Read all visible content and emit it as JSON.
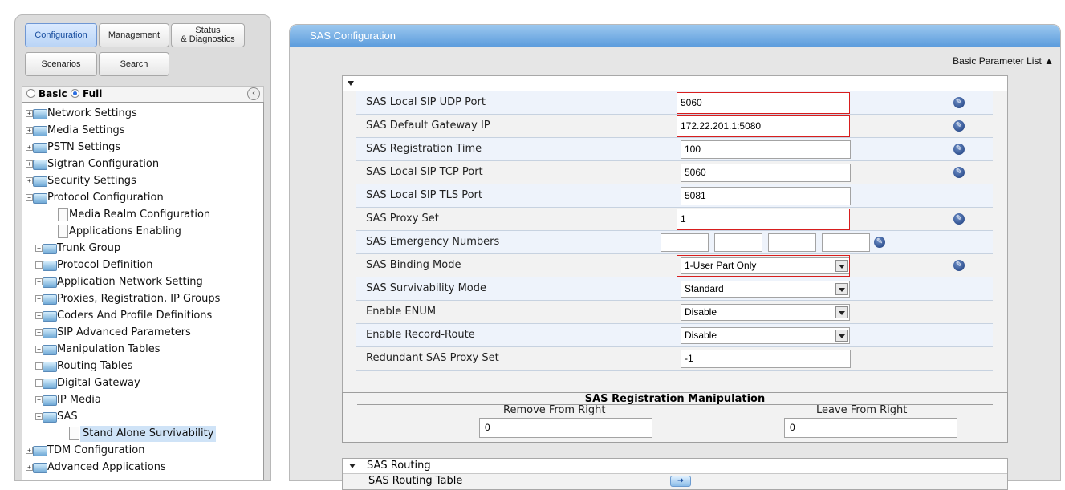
{
  "tabs": {
    "configuration": "Configuration",
    "management": "Management",
    "status_line1": "Status",
    "status_line2": "& Diagnostics",
    "scenarios": "Scenarios",
    "search": "Search"
  },
  "mode": {
    "basic": "Basic",
    "full": "Full",
    "selected": "Full"
  },
  "tree": [
    {
      "label": "Network Settings",
      "level": 0,
      "type": "folder",
      "expanded": false
    },
    {
      "label": "Media Settings",
      "level": 0,
      "type": "folder",
      "expanded": false
    },
    {
      "label": "PSTN Settings",
      "level": 0,
      "type": "folder",
      "expanded": false
    },
    {
      "label": "Sigtran Configuration",
      "level": 0,
      "type": "folder",
      "expanded": false
    },
    {
      "label": "Security Settings",
      "level": 0,
      "type": "folder",
      "expanded": false
    },
    {
      "label": "Protocol Configuration",
      "level": 0,
      "type": "folder",
      "expanded": true
    },
    {
      "label": "Media Realm Configuration",
      "level": 1,
      "type": "page"
    },
    {
      "label": "Applications Enabling",
      "level": 1,
      "type": "page"
    },
    {
      "label": "Trunk Group",
      "level": 1,
      "type": "folder",
      "expanded": false
    },
    {
      "label": "Protocol Definition",
      "level": 1,
      "type": "folder",
      "expanded": false
    },
    {
      "label": "Application Network Setting",
      "level": 1,
      "type": "folder",
      "expanded": false
    },
    {
      "label": "Proxies, Registration, IP Groups",
      "level": 1,
      "type": "folder",
      "expanded": false
    },
    {
      "label": "Coders And Profile Definitions",
      "level": 1,
      "type": "folder",
      "expanded": false
    },
    {
      "label": "SIP Advanced Parameters",
      "level": 1,
      "type": "folder",
      "expanded": false
    },
    {
      "label": "Manipulation Tables",
      "level": 1,
      "type": "folder",
      "expanded": false
    },
    {
      "label": "Routing Tables",
      "level": 1,
      "type": "folder",
      "expanded": false
    },
    {
      "label": "Digital Gateway",
      "level": 1,
      "type": "folder",
      "expanded": false
    },
    {
      "label": "IP Media",
      "level": 1,
      "type": "folder",
      "expanded": false
    },
    {
      "label": "SAS",
      "level": 1,
      "type": "folder",
      "expanded": true
    },
    {
      "label": "Stand Alone Survivability",
      "level": 2,
      "type": "page",
      "selected": true
    },
    {
      "label": "TDM Configuration",
      "level": 0,
      "type": "folder",
      "expanded": false
    },
    {
      "label": "Advanced Applications",
      "level": 0,
      "type": "folder",
      "expanded": false
    }
  ],
  "page": {
    "title": "SAS Configuration",
    "basic_param_list": "Basic Parameter List ▲"
  },
  "params": [
    {
      "label": "SAS Local SIP UDP Port",
      "kind": "input",
      "value": "5060",
      "highlight": true,
      "edit": true
    },
    {
      "label": "SAS Default Gateway IP",
      "kind": "input",
      "value": "172.22.201.1:5080",
      "highlight": true,
      "edit": true
    },
    {
      "label": "SAS Registration Time",
      "kind": "input",
      "value": "100",
      "highlight": false,
      "edit": true
    },
    {
      "label": "SAS Local SIP TCP Port",
      "kind": "input",
      "value": "5060",
      "highlight": false,
      "edit": true
    },
    {
      "label": "SAS Local SIP TLS Port",
      "kind": "input",
      "value": "5081",
      "highlight": false,
      "edit": false
    },
    {
      "label": "SAS Proxy Set",
      "kind": "input",
      "value": "1",
      "highlight": true,
      "edit": true
    },
    {
      "label": "SAS Emergency Numbers",
      "kind": "emergency",
      "values": [
        "",
        "",
        "",
        ""
      ],
      "edit": true
    },
    {
      "label": "SAS Binding Mode",
      "kind": "select",
      "value": "1-User Part Only",
      "highlight": true,
      "edit": true
    },
    {
      "label": "SAS Survivability Mode",
      "kind": "select",
      "value": "Standard",
      "highlight": false,
      "edit": false
    },
    {
      "label": "Enable ENUM",
      "kind": "select",
      "value": "Disable",
      "highlight": false,
      "edit": false
    },
    {
      "label": "Enable Record-Route",
      "kind": "select",
      "value": "Disable",
      "highlight": false,
      "edit": false
    },
    {
      "label": "Redundant SAS Proxy Set",
      "kind": "input",
      "value": "-1",
      "highlight": false,
      "edit": false
    }
  ],
  "manipulation": {
    "title": "SAS Registration Manipulation",
    "remove_label": "Remove From Right",
    "leave_label": "Leave From Right",
    "remove_value": "0",
    "leave_value": "0"
  },
  "routing": {
    "title": "SAS Routing",
    "table_label": "SAS Routing Table"
  },
  "colors": {
    "accent_blue": "#5a9bdc",
    "highlight_red": "#d81e1e"
  }
}
